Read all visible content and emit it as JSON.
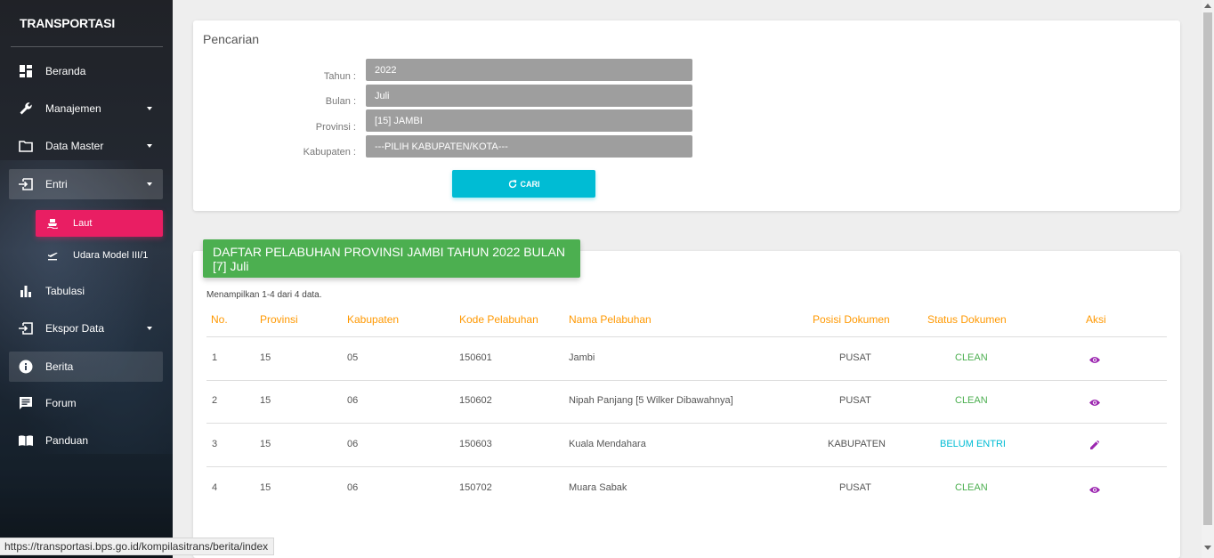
{
  "sidebar": {
    "brand": "TRANSPORTASI",
    "items": [
      {
        "label": "Beranda"
      },
      {
        "label": "Manajemen"
      },
      {
        "label": "Data Master"
      },
      {
        "label": "Entri"
      },
      {
        "label": "Tabulasi"
      },
      {
        "label": "Ekspor Data"
      },
      {
        "label": "Berita"
      },
      {
        "label": "Forum"
      },
      {
        "label": "Panduan"
      }
    ],
    "sub_items": [
      {
        "label": "Laut"
      },
      {
        "label": "Udara Model III/1"
      }
    ]
  },
  "search": {
    "title": "Pencarian",
    "tahun_label": "Tahun :",
    "tahun_value": "2022",
    "bulan_label": "Bulan :",
    "bulan_value": "Juli",
    "provinsi_label": "Provinsi :",
    "provinsi_value": "[15] JAMBI",
    "kabupaten_label": "Kabupaten :",
    "kabupaten_value": "---PILIH KABUPATEN/KOTA---",
    "button_label": "CARI"
  },
  "table": {
    "header_title": "DAFTAR PELABUHAN PROVINSI JAMBI TAHUN 2022 BULAN [7] Juli",
    "showing": "Menampilkan 1-4 dari 4 data.",
    "columns": [
      "No.",
      "Provinsi",
      "Kabupaten",
      "Kode Pelabuhan",
      "Nama Pelabuhan",
      "Posisi Dokumen",
      "Status Dokumen",
      "Aksi"
    ],
    "rows": [
      {
        "no": "1",
        "provinsi": "15",
        "kabupaten": "05",
        "kode": "150601",
        "nama": "Jambi",
        "posisi": "PUSAT",
        "status": "CLEAN",
        "action_icon": "eye-icon"
      },
      {
        "no": "2",
        "provinsi": "15",
        "kabupaten": "06",
        "kode": "150602",
        "nama": "Nipah Panjang [5 Wilker Dibawahnya]",
        "posisi": "PUSAT",
        "status": "CLEAN",
        "action_icon": "eye-icon"
      },
      {
        "no": "3",
        "provinsi": "15",
        "kabupaten": "06",
        "kode": "150603",
        "nama": "Kuala Mendahara",
        "posisi": "KABUPATEN",
        "status": "BELUM ENTRI",
        "action_icon": "pencil-icon"
      },
      {
        "no": "4",
        "provinsi": "15",
        "kabupaten": "06",
        "kode": "150702",
        "nama": "Muara Sabak",
        "posisi": "PUSAT",
        "status": "CLEAN",
        "action_icon": "eye-icon"
      }
    ]
  },
  "statusbar": {
    "url": "https://transportasi.bps.go.id/kompilasitrans/berita/index"
  },
  "colors": {
    "accent_pink": "#e91e63",
    "accent_cyan": "#00bcd4",
    "header_green": "#4caf50",
    "column_orange": "#ff9800",
    "action_purple": "#9c27b0"
  }
}
